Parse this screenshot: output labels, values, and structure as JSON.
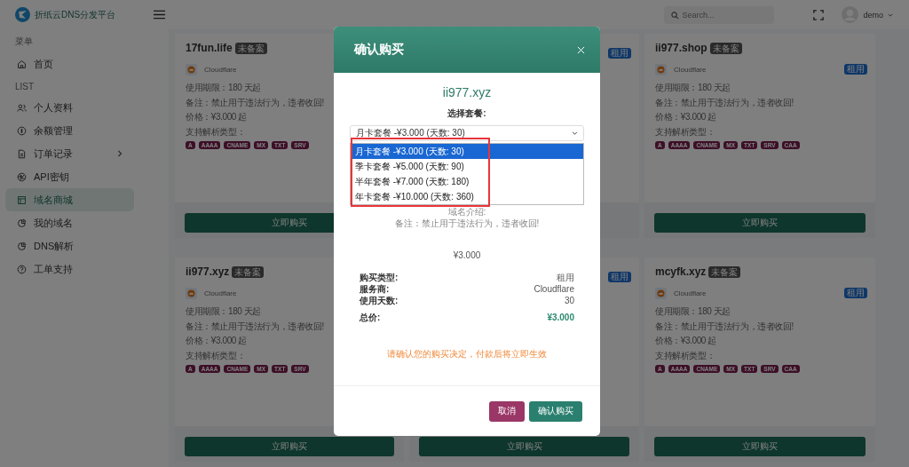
{
  "brand": {
    "name": "折纸云DNS分发平台"
  },
  "header": {
    "search": {
      "placeholder": "Search..."
    },
    "user": "demo"
  },
  "sidebar": {
    "sections": [
      {
        "title": "菜单",
        "items": [
          {
            "label": "首页",
            "selected": false
          }
        ]
      },
      {
        "title": "LIST",
        "items": [
          {
            "label": "个人资料",
            "selected": false
          },
          {
            "label": "余额管理",
            "selected": false
          },
          {
            "label": "订单记录",
            "selected": false,
            "has_children": true
          },
          {
            "label": "API密钥",
            "selected": false
          },
          {
            "label": "域名商城",
            "selected": true
          },
          {
            "label": "我的域名",
            "selected": false
          },
          {
            "label": "DNS解析",
            "selected": false
          },
          {
            "label": "工单支持",
            "selected": false
          }
        ]
      }
    ]
  },
  "cards": [
    {
      "domain": "17fun.life",
      "badge": "未备案",
      "provider": "Cloudflare",
      "lines": [
        "使用期限：180 天起",
        "备注：禁止用于违法行为，违者收回!",
        "价格：¥3.000 起",
        "支持解析类型："
      ],
      "types": [
        "A",
        "AAAA",
        "CNAME",
        "MX",
        "TXT",
        "SRV"
      ],
      "button": "立即购买"
    },
    {
      "rent_tag": "租用"
    },
    {
      "domain": "ii977.shop",
      "badge": "未备案",
      "provider": "Cloudflare",
      "rent_tag": "租用",
      "lines": [
        "使用期限：180 天起",
        "备注：禁止用于违法行为，违者收回!",
        "价格：¥3.000 起",
        "支持解析类型："
      ],
      "types": [
        "A",
        "AAAA",
        "CNAME",
        "MX",
        "TXT",
        "SRV",
        "CAA"
      ],
      "button": "立即购买"
    },
    {
      "domain": "ii977.xyz",
      "badge": "未备案",
      "provider": "Cloudflare",
      "lines": [
        "使用期限：180 天起",
        "备注：禁止用于违法行为，违者收回!",
        "价格：¥3.000 起",
        "支持解析类型："
      ],
      "types": [
        "A",
        "AAAA",
        "CNAME",
        "MX",
        "TXT",
        "SRV"
      ],
      "button": "立即购买"
    },
    {
      "rent_tag": "租用",
      "button": "立即购买"
    },
    {
      "domain": "mcyfk.xyz",
      "badge": "未备案",
      "provider": "Cloudflare",
      "rent_tag": "租用",
      "lines": [
        "使用期限：180 天起",
        "备注：禁止用于违法行为，违者收回!",
        "价格：¥3.000 起",
        "支持解析类型："
      ],
      "types": [
        "A",
        "AAAA",
        "CNAME",
        "MX",
        "TXT",
        "SRV",
        "CAA"
      ],
      "button": "立即购买"
    }
  ],
  "modal": {
    "title": "确认购买",
    "domain": "ii977.xyz",
    "select_label": "选择套餐:",
    "select_value": "月卡套餐 -¥3.000 (天数: 30)",
    "dropdown": {
      "highlighted": true,
      "options": [
        {
          "label": "月卡套餐 -¥3.000 (天数: 30)",
          "selected": true
        },
        {
          "label": "季卡套餐 -¥5.000 (天数: 90)",
          "selected": false
        },
        {
          "label": "半年套餐 -¥7.000 (天数: 180)",
          "selected": false
        },
        {
          "label": "年卡套餐 -¥10.000 (天数: 360)",
          "selected": false
        }
      ]
    },
    "intro_label": "域名介绍:",
    "intro_text": "备注：禁止用于违法行为，违者收回!",
    "price": "¥3.000",
    "details": [
      {
        "label": "购买类型:",
        "value": "租用"
      },
      {
        "label": "服务商:",
        "value": "Cloudflare"
      },
      {
        "label": "使用天数:",
        "value": "30"
      }
    ],
    "total": {
      "label": "总价:",
      "value": "¥3.000"
    },
    "notice": "请确认您的购买决定，付款后将立即生效",
    "buttons": [
      {
        "label": "取消",
        "kind": "cancel"
      },
      {
        "label": "确认购买",
        "kind": "confirm"
      }
    ]
  }
}
